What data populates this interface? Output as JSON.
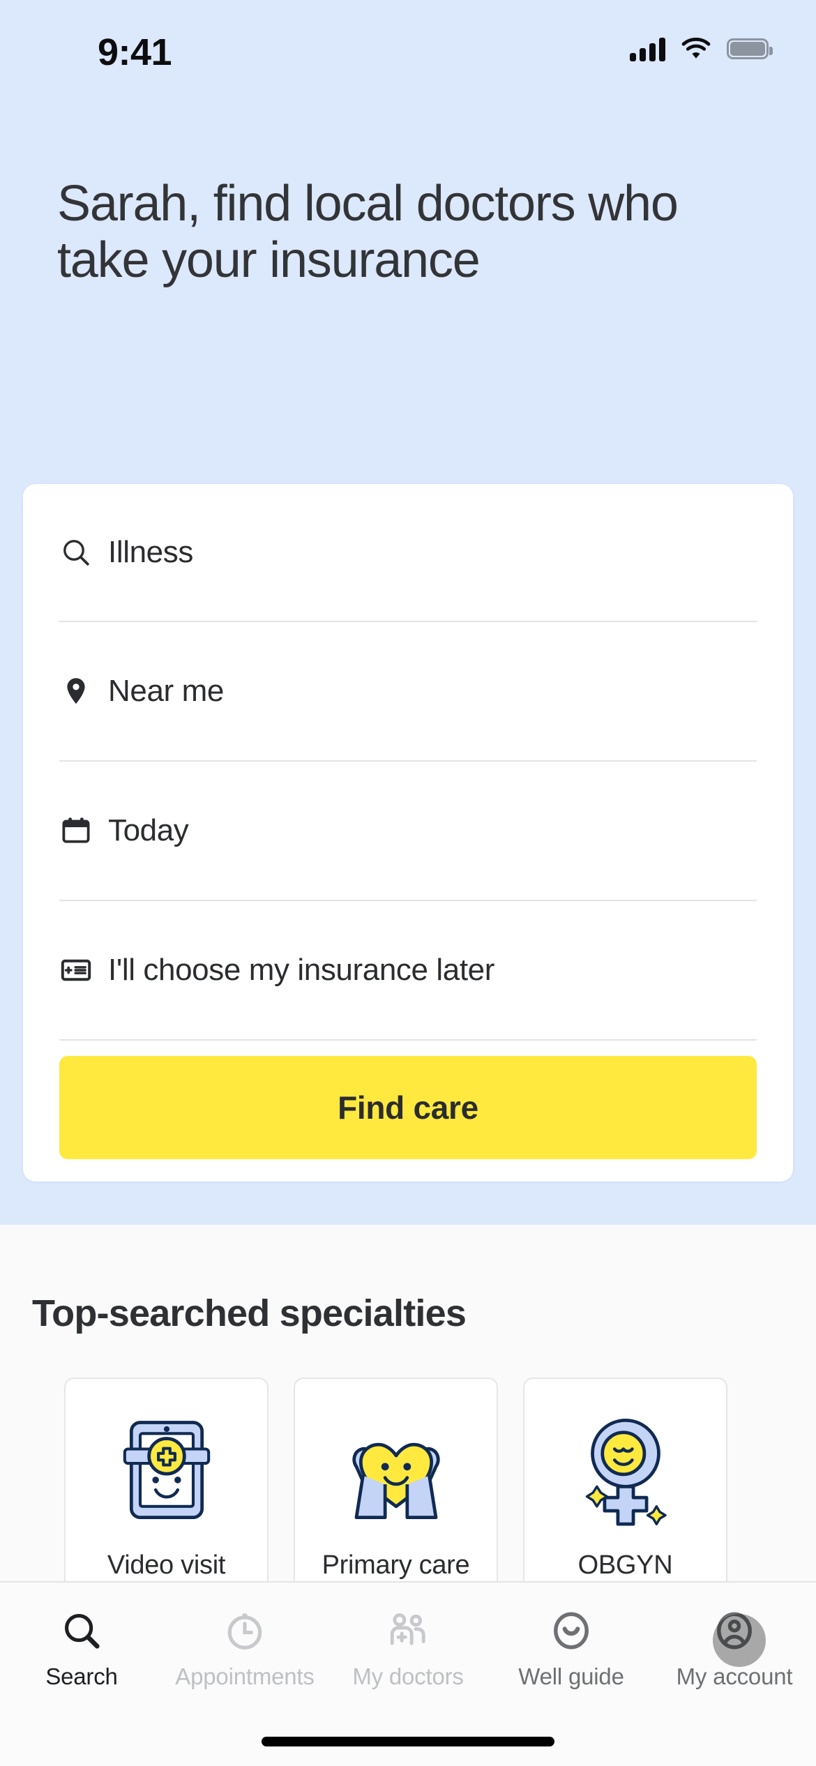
{
  "status_bar": {
    "time": "9:41",
    "cellular_icon": "signal-bars-icon",
    "wifi_icon": "wifi-icon",
    "battery_icon": "battery-icon"
  },
  "header": {
    "headline": "Sarah, find local doctors who take your insurance"
  },
  "search_card": {
    "fields": [
      {
        "icon": "search-icon",
        "label": "Illness"
      },
      {
        "icon": "location-pin-icon",
        "label": "Near me"
      },
      {
        "icon": "calendar-icon",
        "label": "Today"
      },
      {
        "icon": "insurance-card-icon",
        "label": "I'll choose my insurance later"
      }
    ],
    "submit_label": "Find care"
  },
  "specialties": {
    "section_title": "Top-searched specialties",
    "cards": [
      {
        "label": "Video visit",
        "art": "tablet-with-medical-cross-illustration"
      },
      {
        "label": "Primary care",
        "art": "hands-holding-heart-illustration"
      },
      {
        "label": "OBGYN",
        "art": "female-symbol-smiley-illustration"
      }
    ]
  },
  "tab_bar": {
    "items": [
      {
        "label": "Search",
        "icon": "search-icon",
        "state": "active"
      },
      {
        "label": "Appointments",
        "icon": "clock-icon",
        "state": "inactive"
      },
      {
        "label": "My doctors",
        "icon": "people-plus-icon",
        "state": "inactive"
      },
      {
        "label": "Well guide",
        "icon": "smiley-face-icon",
        "state": "inactive"
      },
      {
        "label": "My account",
        "icon": "account-icon",
        "state": "inactive"
      }
    ]
  },
  "colors": {
    "hero_background": "#DCE8FB",
    "accent_yellow": "#FFE93F",
    "illustration_blue": "#C3D4F7",
    "illustration_outline": "#102A52",
    "text_primary": "#2B2C2F"
  }
}
